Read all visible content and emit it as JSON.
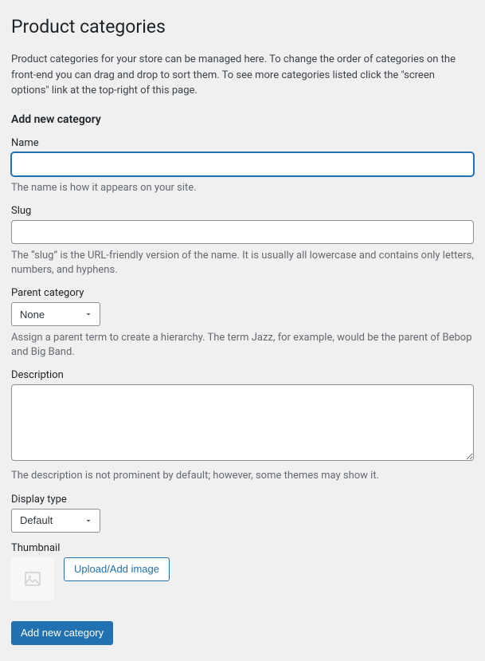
{
  "page": {
    "title": "Product categories",
    "intro": "Product categories for your store can be managed here. To change the order of categories on the front-end you can drag and drop to sort them. To see more categories listed click the \"screen options\" link at the top-right of this page."
  },
  "form": {
    "heading": "Add new category",
    "name": {
      "label": "Name",
      "value": "",
      "help": "The name is how it appears on your site."
    },
    "slug": {
      "label": "Slug",
      "value": "",
      "help": "The “slug” is the URL-friendly version of the name. It is usually all lowercase and contains only letters, numbers, and hyphens."
    },
    "parent": {
      "label": "Parent category",
      "selected": "None",
      "help": "Assign a parent term to create a hierarchy. The term Jazz, for example, would be the parent of Bebop and Big Band."
    },
    "description": {
      "label": "Description",
      "value": "",
      "help": "The description is not prominent by default; however, some themes may show it."
    },
    "display_type": {
      "label": "Display type",
      "selected": "Default"
    },
    "thumbnail": {
      "label": "Thumbnail",
      "upload_button": "Upload/Add image"
    },
    "submit": "Add new category"
  }
}
